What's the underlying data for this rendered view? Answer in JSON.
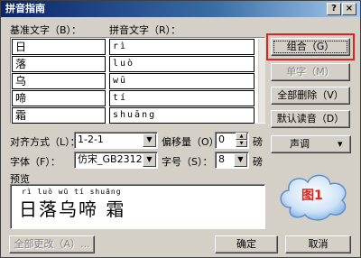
{
  "window": {
    "title": "拼音指南",
    "help_label": "?",
    "close_label": "×"
  },
  "columns": {
    "base": "基准文字（B）：",
    "ruby": "拼音文字（R）："
  },
  "rows": [
    {
      "base": "日",
      "ruby": "rì"
    },
    {
      "base": "落",
      "ruby": "luò"
    },
    {
      "base": "乌",
      "ruby": "wū"
    },
    {
      "base": "啼",
      "ruby": "tí"
    },
    {
      "base": "霜",
      "ruby": "shuāng"
    }
  ],
  "buttons": {
    "combine": "组合（G）",
    "single": "单字（M）",
    "delete_all": "全部删除（V）",
    "default_reading": "默认读音（D）",
    "tone": "声调",
    "change_all": "全部更改（A）...",
    "ok": "确定",
    "cancel": "取消"
  },
  "options": {
    "alignment_label": "对齐方式（L）：",
    "alignment_value": "1-2-1",
    "offset_label": "偏移量（O）：",
    "offset_value": "0",
    "offset_unit": "磅",
    "font_label": "字体（F）：",
    "font_value": "仿宋_GB2312",
    "size_label": "字号（S）：",
    "size_value": "8",
    "size_unit": "磅"
  },
  "preview": {
    "label": "预览",
    "pinyin": "rì luò wū tí shuāng",
    "text": "日落乌啼 霜"
  },
  "annotation": {
    "text": "图1",
    "accent_color": "#e2231a"
  },
  "icons": {
    "dropdown": "chevron-down-icon",
    "spin_up": "spin-up-icon",
    "spin_down": "spin-down-icon"
  }
}
